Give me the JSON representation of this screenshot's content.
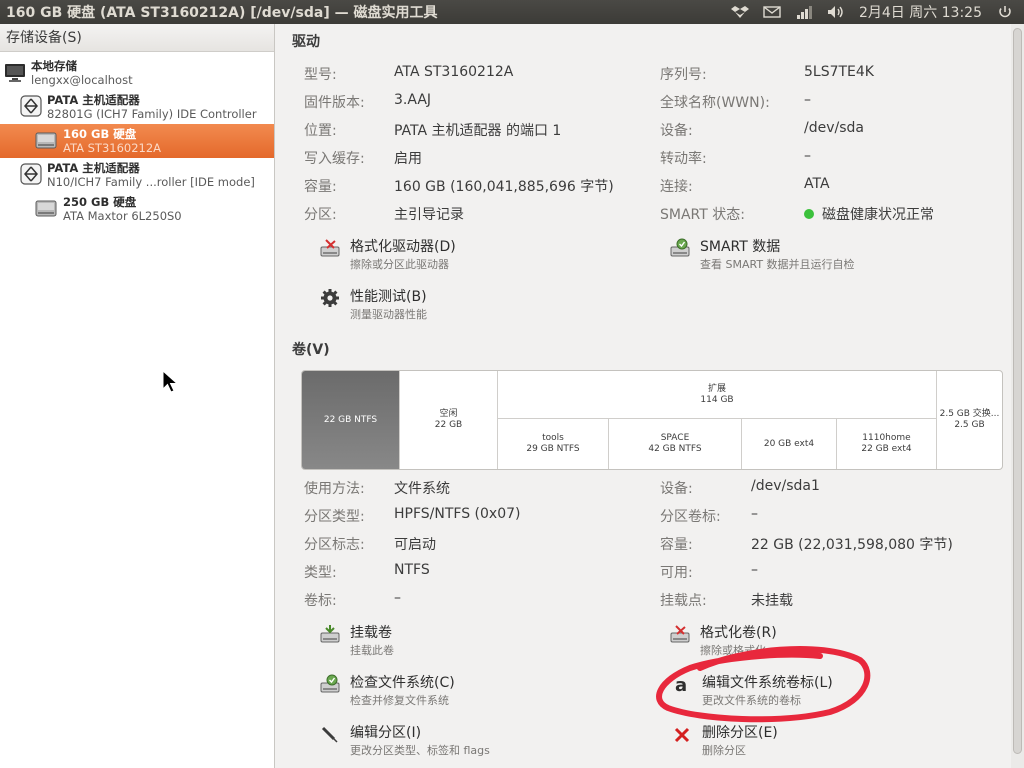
{
  "window": {
    "title": "160 GB 硬盘 (ATA ST3160212A) [/dev/sda] — 磁盘实用工具"
  },
  "tray": {
    "datetime": "2月4日 周六 13:25"
  },
  "sidebar": {
    "header": "存储设备(S)",
    "items": [
      {
        "title": "本地存储",
        "subtitle": "lengxx@localhost",
        "icon": "monitor-icon"
      },
      {
        "title": "PATA 主机适配器",
        "subtitle": "82801G (ICH7 Family) IDE Controller",
        "icon": "controller-icon"
      },
      {
        "title": "160 GB 硬盘",
        "subtitle": "ATA ST3160212A",
        "icon": "harddisk-icon",
        "selected": true
      },
      {
        "title": "PATA 主机适配器",
        "subtitle": "N10/ICH7 Family ...roller [IDE mode]",
        "icon": "controller-icon"
      },
      {
        "title": "250 GB 硬盘",
        "subtitle": "ATA Maxtor 6L250S0",
        "icon": "harddisk-icon"
      }
    ]
  },
  "drive": {
    "section": "驱动",
    "left": [
      {
        "label": "型号:",
        "value": "ATA ST3160212A"
      },
      {
        "label": "固件版本:",
        "value": "3.AAJ"
      },
      {
        "label": "位置:",
        "value": "PATA 主机适配器 的端口 1"
      },
      {
        "label": "写入缓存:",
        "value": "启用"
      },
      {
        "label": "容量:",
        "value": "160 GB (160,041,885,696 字节)"
      },
      {
        "label": "分区:",
        "value": "主引导记录"
      }
    ],
    "right": [
      {
        "label": "序列号:",
        "value": "5LS7TE4K"
      },
      {
        "label": "全球名称(WWN):",
        "value": "–"
      },
      {
        "label": "设备:",
        "value": "/dev/sda"
      },
      {
        "label": "转动率:",
        "value": "–"
      },
      {
        "label": "连接:",
        "value": "ATA"
      },
      {
        "label": "SMART 状态:",
        "value": "磁盘健康状况正常"
      }
    ],
    "actions": [
      {
        "title": "格式化驱动器(D)",
        "subtitle": "擦除或分区此驱动器"
      },
      {
        "title": "SMART 数据",
        "subtitle": "查看 SMART 数据并且运行自检"
      },
      {
        "title": "性能测试(B)",
        "subtitle": "测量驱动器性能"
      }
    ]
  },
  "volumes": {
    "section": "卷(V)",
    "segments": [
      {
        "l1": "22 GB NTFS",
        "l2": ""
      },
      {
        "l1": "空闲",
        "l2": "22 GB"
      },
      {
        "l1": "扩展",
        "l2": "114 GB"
      },
      {
        "l1": "2.5 GB 交换...",
        "l2": "2.5 GB"
      },
      {
        "l1": "tools",
        "l2": "29 GB NTFS"
      },
      {
        "l1": "SPACE",
        "l2": "42 GB NTFS"
      },
      {
        "l1": "20 GB ext4",
        "l2": ""
      },
      {
        "l1": "1110home",
        "l2": "22 GB ext4"
      }
    ],
    "left": [
      {
        "label": "使用方法:",
        "value": "文件系统"
      },
      {
        "label": "分区类型:",
        "value": "HPFS/NTFS (0x07)"
      },
      {
        "label": "分区标志:",
        "value": "可启动"
      },
      {
        "label": "类型:",
        "value": "NTFS"
      },
      {
        "label": "卷标:",
        "value": "–"
      }
    ],
    "right": [
      {
        "label": "设备:",
        "value": "/dev/sda1"
      },
      {
        "label": "分区卷标:",
        "value": "–"
      },
      {
        "label": "容量:",
        "value": "22 GB (22,031,598,080 字节)"
      },
      {
        "label": "可用:",
        "value": "–"
      },
      {
        "label": "挂载点:",
        "value": "未挂载"
      }
    ],
    "actions": [
      {
        "title": "挂载卷",
        "subtitle": "挂载此卷"
      },
      {
        "title": "格式化卷(R)",
        "subtitle": "擦除或格式化"
      },
      {
        "title": "检查文件系统(C)",
        "subtitle": "检查并修复文件系统"
      },
      {
        "title": "编辑文件系统卷标(L)",
        "subtitle": "更改文件系统的卷标"
      },
      {
        "title": "编辑分区(I)",
        "subtitle": "更改分区类型、标签和 flags"
      },
      {
        "title": "删除分区(E)",
        "subtitle": "删除分区"
      }
    ]
  },
  "colors": {
    "selection": "#e4692b",
    "annotation": "#e8283c",
    "health": "#3cc13c"
  }
}
